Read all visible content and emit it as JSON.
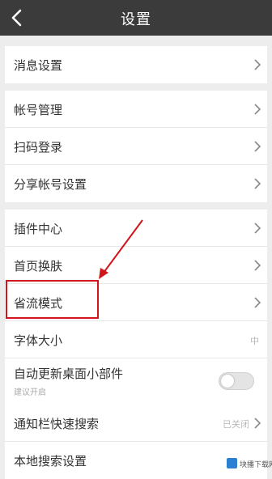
{
  "header": {
    "title": "设置",
    "back_icon": "chevron-left-icon"
  },
  "groups": [
    {
      "items": [
        {
          "label": "消息设置"
        }
      ]
    },
    {
      "items": [
        {
          "label": "帐号管理"
        },
        {
          "label": "扫码登录"
        },
        {
          "label": "分享帐号设置"
        }
      ]
    },
    {
      "items": [
        {
          "label": "插件中心"
        },
        {
          "label": "首页换肤"
        },
        {
          "label": "省流模式"
        },
        {
          "label": "字体大小",
          "value": "中"
        },
        {
          "label": "自动更新桌面小部件",
          "sublabel": "建议开启",
          "toggle_on": false
        }
      ]
    },
    {
      "items": [
        {
          "label": "通知栏快速搜索",
          "value": "已关闭"
        },
        {
          "label": "本地搜索设置"
        }
      ]
    }
  ],
  "annotation": {
    "color": "#d0151b",
    "target": "省流模式"
  },
  "watermark": {
    "text": "块播下载网"
  },
  "colors": {
    "titlebar": "#3b3b3b",
    "background": "#ededed",
    "highlight": "#d0151b"
  }
}
